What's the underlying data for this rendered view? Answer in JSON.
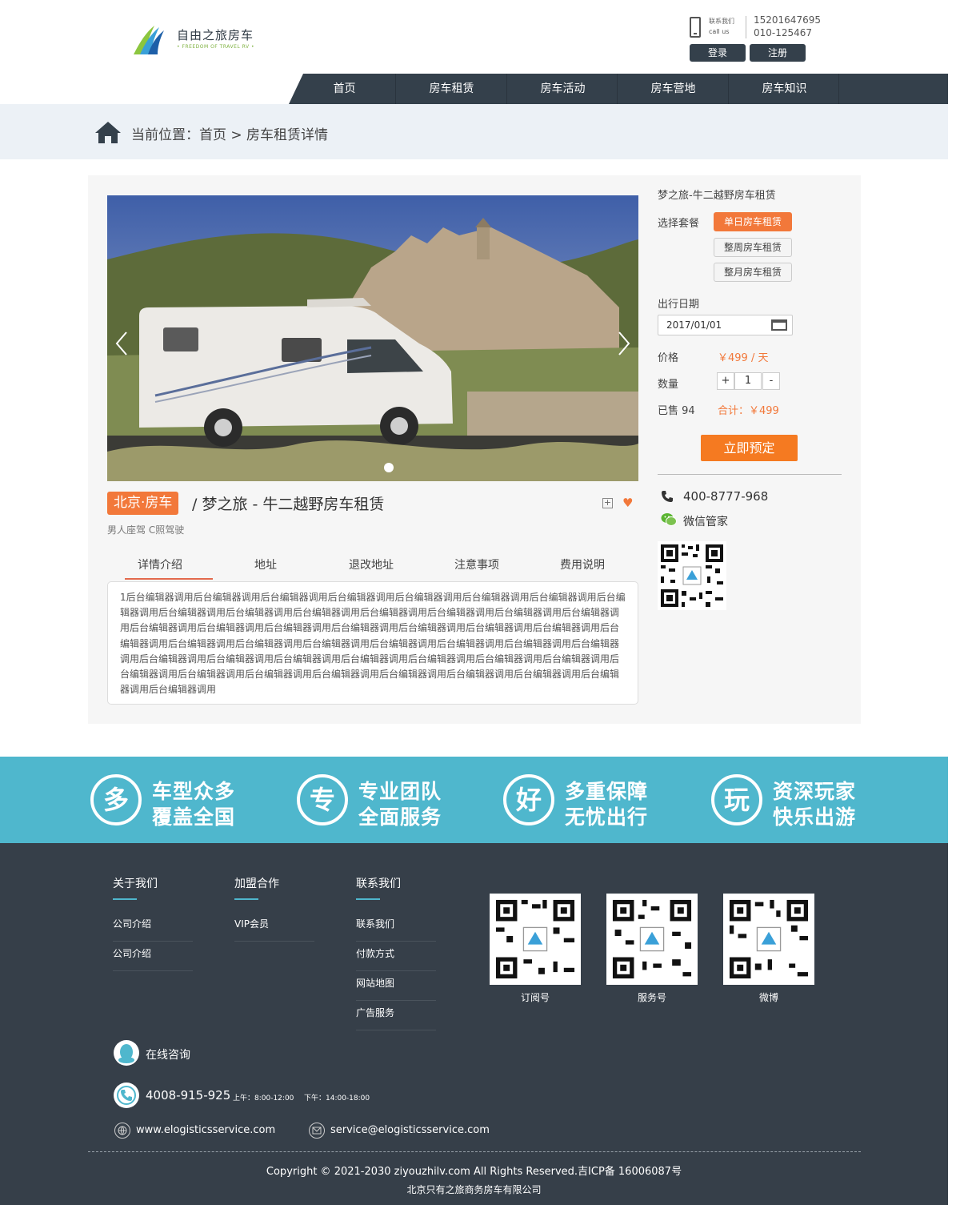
{
  "header": {
    "logo_cn": "自由之旅房车",
    "logo_en": "• FREEDOM OF TRAVEL RV •",
    "callus_cn": "联系我们",
    "callus_en": "call us",
    "phone1": "15201647695",
    "phone2": "010-125467",
    "login_label": "登录",
    "register_label": "注册"
  },
  "nav": {
    "items": [
      "首页",
      "房车租赁",
      "房车活动",
      "房车营地",
      "房车知识"
    ]
  },
  "breadcrumb": {
    "text": "当前位置：首页 > 房车租赁详情"
  },
  "product": {
    "tag": "北京·房车",
    "title": "/ 梦之旅 - 牛二越野房车租赁",
    "subtitle": "男人座驾 C照驾驶",
    "tabs": [
      "详情介绍",
      "地址",
      "退改地址",
      "注意事项",
      "费用说明"
    ],
    "active_tab": 0,
    "description": "1后台编辑器调用后台编辑器调用后台编辑器调用后台编辑器调用后台编辑器调用后台编辑器调用后台编辑器调用后台编辑器调用后台编辑器调用后台编辑器调用后台编辑器调用后台编辑器调用后台编辑器调用后台编辑器调用后台编辑器调用后台编辑器调用后台编辑器调用后台编辑器调用后台编辑器调用后台编辑器调用后台编辑器调用后台编辑器调用后台编辑器调用后台编辑器调用后台编辑器调用后台编辑器调用后台编辑器调用后台编辑器调用后台编辑器调用后台编辑器调用后台编辑器调用后台编辑器调用后台编辑器调用后台编辑器调用后台编辑器调用后台编辑器调用后台编辑器调用后台编辑器调用后台编辑器调用后台编辑器调用后台编辑器调用后台编辑器调用后台编辑器调用后台编辑器调用后台编辑器调用后台编辑器调用"
  },
  "booking": {
    "title": "梦之旅-牛二越野房车租赁",
    "package_label": "选择套餐",
    "packages": [
      "单日房车租赁",
      "整周房车租赁",
      "整月房车租赁"
    ],
    "active_package": 0,
    "date_label": "出行日期",
    "date_value": "2017/01/01",
    "price_label": "价格",
    "price_value": "￥499 / 天",
    "qty_label": "数量",
    "qty_plus": "+",
    "qty_value": "1",
    "qty_minus": "-",
    "sold_label": "已售 94",
    "total_label": "合计：￥499",
    "book_label": "立即预定",
    "hotline": "400-8777-968",
    "wechat": "微信管家"
  },
  "features": [
    {
      "icon_char": "多",
      "line1": "车型众多",
      "line2": "覆盖全国"
    },
    {
      "icon_char": "专",
      "line1": "专业团队",
      "line2": "全面服务"
    },
    {
      "icon_char": "好",
      "line1": "多重保障",
      "line2": "无忧出行"
    },
    {
      "icon_char": "玩",
      "line1": "资深玩家",
      "line2": "快乐出游"
    }
  ],
  "footer": {
    "col1": {
      "title": "关于我们",
      "links": [
        "公司介绍",
        "公司介绍"
      ]
    },
    "col2": {
      "title": "加盟合作",
      "links": [
        "VIP会员"
      ]
    },
    "col3": {
      "title": "联系我们",
      "links": [
        "联系我们",
        "付款方式",
        "网站地图",
        "广告服务"
      ]
    },
    "qrcodes": [
      "订阅号",
      "服务号",
      "微博"
    ],
    "online": "在线咨询",
    "phone": "4008-915-925",
    "hours_am": "上午：8:00-12:00",
    "hours_pm": "下午：14:00-18:00",
    "website": "www.elogisticsservice.com",
    "email": "service@elogisticsservice.com",
    "copyright": "Copyright © 2021-2030 ziyouzhilv.com All Rights Reserved.吉ICP备 16006087号",
    "company": "北京只有之旅商务房车有限公司"
  },
  "colors": {
    "nav_bg": "#34404b",
    "accent_orange": "#f2783a",
    "band_blue": "#4fb7cd",
    "footer_bg": "#363f49"
  }
}
